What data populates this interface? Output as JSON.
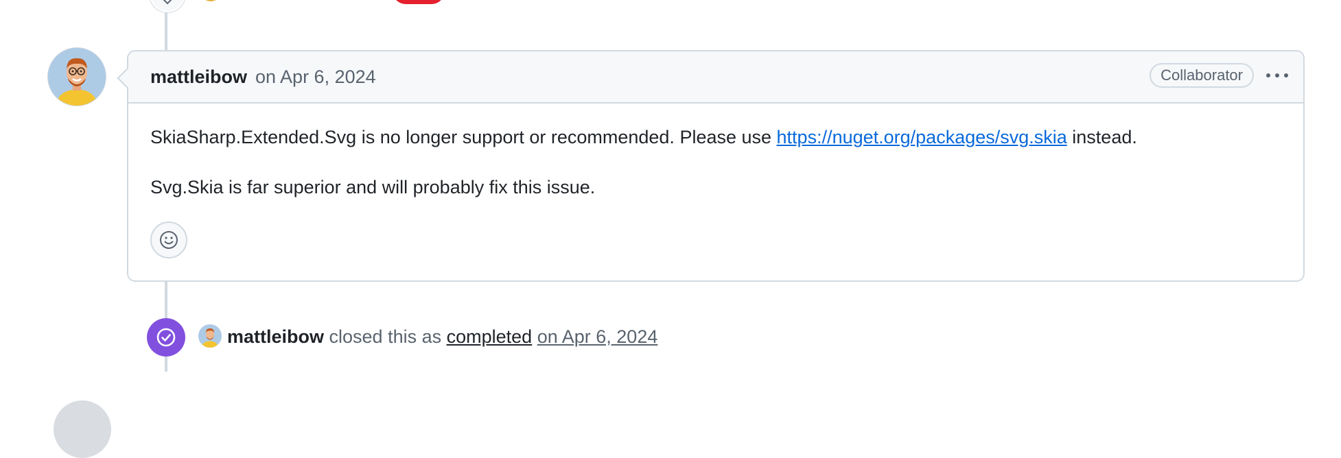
{
  "comment": {
    "author": "mattleibow",
    "date": "on Apr 6, 2024",
    "role": "Collaborator",
    "more_label": "Show options",
    "body_p1_before_link": "SkiaSharp.Extended.Svg is no longer support or recommended. Please use ",
    "body_link": "https://nuget.org/packages/svg.skia",
    "body_p1_after_link": " instead.",
    "body_p2": "Svg.Skia is far superior and will probably fix this issue.",
    "reaction_icon": "smiley-icon"
  },
  "closed_event": {
    "actor": "mattleibow",
    "text_before": " closed this as ",
    "state": "completed",
    "date": "on Apr 6, 2024",
    "icon": "check-circle-icon",
    "badge_color": "#8250df"
  },
  "colors": {
    "link": "#0969da",
    "muted": "#59636e",
    "border": "#d1d9e0",
    "header_bg": "#f6f8fa"
  }
}
